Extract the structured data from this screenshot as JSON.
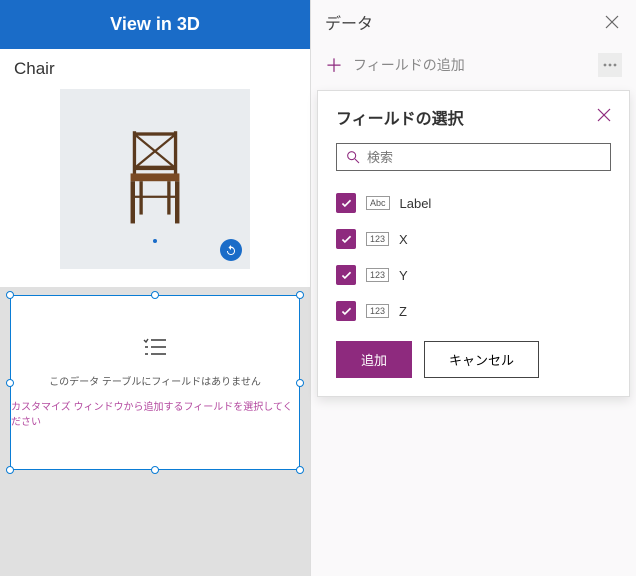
{
  "colors": {
    "accent": "#8e2a7e",
    "header": "#1a6cc8"
  },
  "header": {
    "title": "View in 3D"
  },
  "scene": {
    "label": "Chair"
  },
  "dataTable": {
    "emptyLine1": "このデータ テーブルにフィールドはありません",
    "emptyLine2": "カスタマイズ ウィンドウから追加するフィールドを選択してください"
  },
  "rightPanel": {
    "title": "データ",
    "addField": "フィールドの追加"
  },
  "fieldPopup": {
    "title": "フィールドの選択",
    "searchPlaceholder": "検索",
    "fields": [
      {
        "type": "Abc",
        "label": "Label",
        "checked": true
      },
      {
        "type": "123",
        "label": "X",
        "checked": true
      },
      {
        "type": "123",
        "label": "Y",
        "checked": true
      },
      {
        "type": "123",
        "label": "Z",
        "checked": true
      }
    ],
    "addLabel": "追加",
    "cancelLabel": "キャンセル"
  }
}
